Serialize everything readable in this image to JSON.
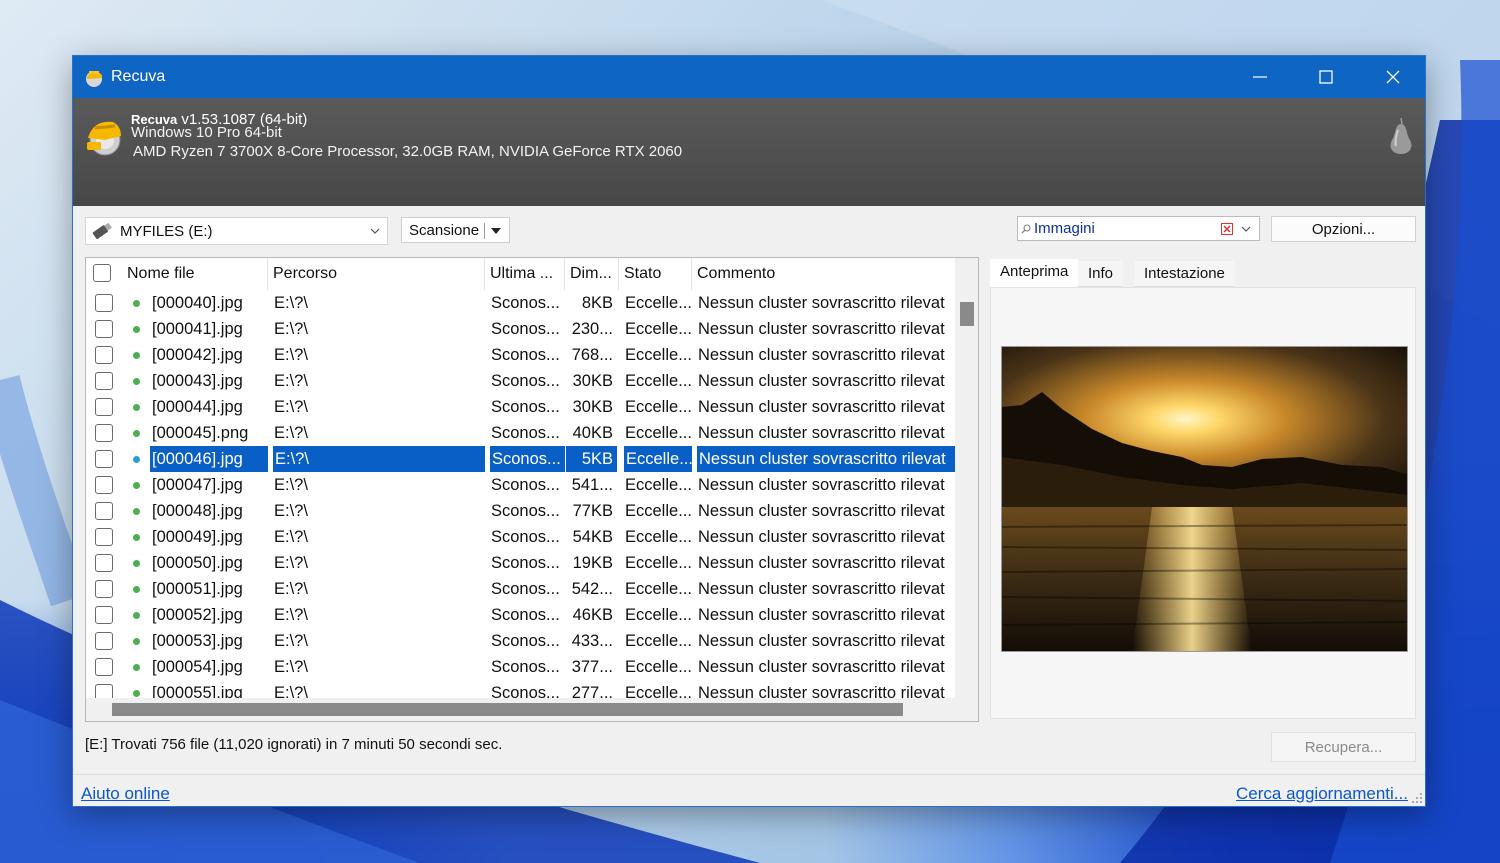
{
  "window": {
    "title": "Recuva"
  },
  "header": {
    "app_name": "Recuva",
    "version": "v1.53.1087 (64-bit)",
    "os": "Windows 10 Pro 64-bit",
    "hardware": "AMD Ryzen 7 3700X 8-Core Processor, 32.0GB RAM, NVIDIA GeForce RTX 2060"
  },
  "toolbar": {
    "drive": "MYFILES (E:)",
    "scan_label": "Scansione",
    "filter_value": "Immagini",
    "options_label": "Opzioni..."
  },
  "list": {
    "columns": [
      "Nome file",
      "Percorso",
      "Ultima ...",
      "Dim...",
      "Stato",
      "Commento"
    ],
    "rows": [
      {
        "name": "[000040].jpg",
        "path": "E:\\?\\",
        "last": "Sconos...",
        "size": "8KB",
        "state": "Eccelle...",
        "comment": "Nessun cluster sovrascritto rilevat",
        "selected": false
      },
      {
        "name": "[000041].jpg",
        "path": "E:\\?\\",
        "last": "Sconos...",
        "size": "230...",
        "state": "Eccelle...",
        "comment": "Nessun cluster sovrascritto rilevat",
        "selected": false
      },
      {
        "name": "[000042].jpg",
        "path": "E:\\?\\",
        "last": "Sconos...",
        "size": "768...",
        "state": "Eccelle...",
        "comment": "Nessun cluster sovrascritto rilevat",
        "selected": false
      },
      {
        "name": "[000043].jpg",
        "path": "E:\\?\\",
        "last": "Sconos...",
        "size": "30KB",
        "state": "Eccelle...",
        "comment": "Nessun cluster sovrascritto rilevat",
        "selected": false
      },
      {
        "name": "[000044].jpg",
        "path": "E:\\?\\",
        "last": "Sconos...",
        "size": "30KB",
        "state": "Eccelle...",
        "comment": "Nessun cluster sovrascritto rilevat",
        "selected": false
      },
      {
        "name": "[000045].png",
        "path": "E:\\?\\",
        "last": "Sconos...",
        "size": "40KB",
        "state": "Eccelle...",
        "comment": "Nessun cluster sovrascritto rilevat",
        "selected": false
      },
      {
        "name": "[000046].jpg",
        "path": "E:\\?\\",
        "last": "Sconos...",
        "size": "5KB",
        "state": "Eccelle...",
        "comment": "Nessun cluster sovrascritto rilevat",
        "selected": true
      },
      {
        "name": "[000047].jpg",
        "path": "E:\\?\\",
        "last": "Sconos...",
        "size": "541...",
        "state": "Eccelle...",
        "comment": "Nessun cluster sovrascritto rilevat",
        "selected": false
      },
      {
        "name": "[000048].jpg",
        "path": "E:\\?\\",
        "last": "Sconos...",
        "size": "77KB",
        "state": "Eccelle...",
        "comment": "Nessun cluster sovrascritto rilevat",
        "selected": false
      },
      {
        "name": "[000049].jpg",
        "path": "E:\\?\\",
        "last": "Sconos...",
        "size": "54KB",
        "state": "Eccelle...",
        "comment": "Nessun cluster sovrascritto rilevat",
        "selected": false
      },
      {
        "name": "[000050].jpg",
        "path": "E:\\?\\",
        "last": "Sconos...",
        "size": "19KB",
        "state": "Eccelle...",
        "comment": "Nessun cluster sovrascritto rilevat",
        "selected": false
      },
      {
        "name": "[000051].jpg",
        "path": "E:\\?\\",
        "last": "Sconos...",
        "size": "542...",
        "state": "Eccelle...",
        "comment": "Nessun cluster sovrascritto rilevat",
        "selected": false
      },
      {
        "name": "[000052].jpg",
        "path": "E:\\?\\",
        "last": "Sconos...",
        "size": "46KB",
        "state": "Eccelle...",
        "comment": "Nessun cluster sovrascritto rilevat",
        "selected": false
      },
      {
        "name": "[000053].jpg",
        "path": "E:\\?\\",
        "last": "Sconos...",
        "size": "433...",
        "state": "Eccelle...",
        "comment": "Nessun cluster sovrascritto rilevat",
        "selected": false
      },
      {
        "name": "[000054].jpg",
        "path": "E:\\?\\",
        "last": "Sconos...",
        "size": "377...",
        "state": "Eccelle...",
        "comment": "Nessun cluster sovrascritto rilevat",
        "selected": false
      },
      {
        "name": "[000055].jpg",
        "path": "E:\\?\\",
        "last": "Sconos...",
        "size": "277...",
        "state": "Eccelle...",
        "comment": "Nessun cluster sovrascritto rilevat",
        "selected": false
      }
    ],
    "status_dot_color": "#4caf50",
    "selected_dot_color": "#2a9fd6",
    "selection_color": "#0a5fc7"
  },
  "preview": {
    "tabs": [
      "Anteprima",
      "Info",
      "Intestazione"
    ],
    "active_tab": "Anteprima"
  },
  "status_text": "[E:] Trovati 756 file (11,020 ignorati) in 7 minuti 50 secondi sec.",
  "recover_label": "Recupera...",
  "footer": {
    "help_link": "Aiuto online",
    "update_link": "Cerca aggiornamenti..."
  },
  "colors": {
    "titlebar": "#0f65c4",
    "link": "#0b57c9"
  }
}
